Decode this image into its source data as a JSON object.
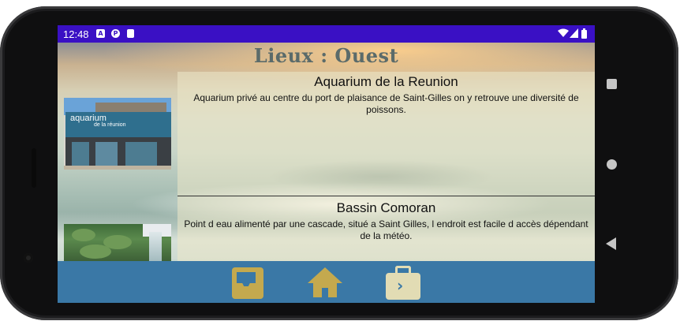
{
  "status_bar": {
    "time": "12:48",
    "left_icons": [
      "a-icon",
      "p-icon",
      "sd-card-icon"
    ],
    "right_icons": [
      "wifi-icon",
      "signal-icon",
      "battery-icon"
    ]
  },
  "screen": {
    "title": "Lieux : Ouest",
    "places": [
      {
        "name": "Aquarium de la Reunion",
        "description": "Aquarium privé au centre du port de plaisance de Saint-Gilles on y retrouve une diversité de poissons.",
        "thumbnail": {
          "sign_main": "aquarium",
          "sign_sub": "de la réunion"
        }
      },
      {
        "name": "Bassin Comoran",
        "description": "Point d eau alimenté par une cascade, situé a Saint Gilles, l endroit est facile d accès dépendant de la météo."
      }
    ]
  },
  "bottom_nav": {
    "items": [
      "inbox-icon",
      "home-icon",
      "briefcase-icon"
    ],
    "background": "#3a78a6",
    "icon_color": "#c4a94e"
  },
  "android_nav": [
    "recents-button",
    "home-button",
    "back-button"
  ],
  "colors": {
    "status_bar": "#3a10c4",
    "title": "#5b6b6a"
  }
}
